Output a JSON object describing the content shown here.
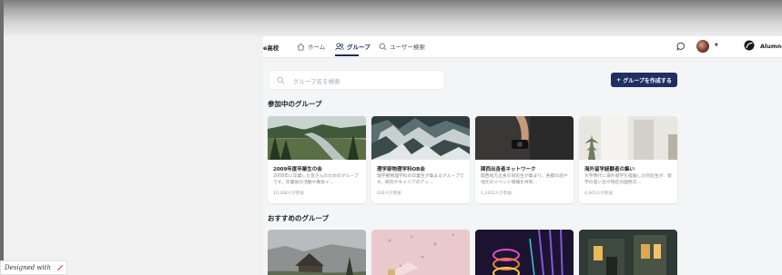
{
  "nav": {
    "brand": "e高校",
    "items": [
      {
        "label": "ホーム",
        "icon": "home-icon"
      },
      {
        "label": "グループ",
        "icon": "group-icon",
        "active": true
      },
      {
        "label": "ユーザー検索",
        "icon": "search-icon"
      }
    ],
    "brand_right": "Alumno"
  },
  "search": {
    "placeholder": "グループ名を検索"
  },
  "create_button": {
    "label": "グループを作成する",
    "prefix": "+"
  },
  "sections": {
    "joined": "参加中のグループ",
    "recommended": "おすすめのグループ"
  },
  "joined_groups": [
    {
      "title": "2009年度卒業生の会",
      "desc": "2009年に卒業した皆さんのためのグループです。卒業後の活動や再会イ...",
      "members": "10,268人が参加"
    },
    {
      "title": "理学部物理学科OB会",
      "desc": "理学部物理学科の卒業生が集まるグループです。研究やキャリアのアッ...",
      "members": "628人が参加"
    },
    {
      "title": "関西出身者ネットワーク",
      "desc": "関西地方出身の同窓生が集まり、各都の話や地元のイベント情報を共有...",
      "members": "1,3161人が参加"
    },
    {
      "title": "海外留学経験者の集い",
      "desc": "大学時代に海外留学を経験した同窓生が、留学の思い出や現在の国際交...",
      "members": "4,905人が参加"
    }
  ],
  "footer": {
    "designed_with": "Designed with"
  },
  "colors": {
    "accent": "#1f2f62",
    "background": "#f4f5f7"
  }
}
